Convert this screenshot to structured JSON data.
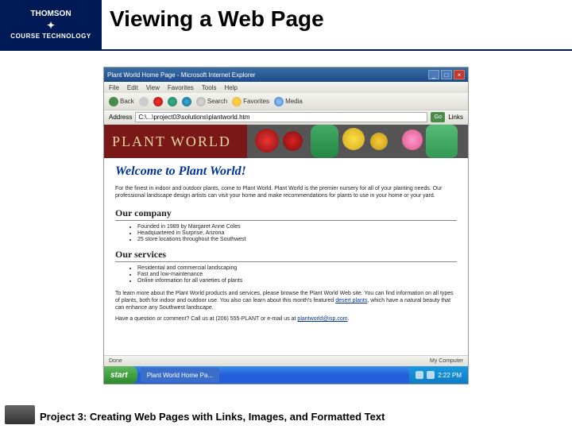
{
  "slide": {
    "logo_top": "THOMSON",
    "logo_bottom": "COURSE TECHNOLOGY",
    "title": "Viewing a Web Page",
    "footer": "Project 3: Creating Web Pages with Links, Images, and Formatted Text"
  },
  "browser": {
    "window_title": "Plant World Home Page - Microsoft Internet Explorer",
    "menu": [
      "File",
      "Edit",
      "View",
      "Favorites",
      "Tools",
      "Help"
    ],
    "toolbar": {
      "back": "Back",
      "search": "Search",
      "favorites": "Favorites",
      "media": "Media"
    },
    "address_label": "Address",
    "address_value": "C:\\...\\project03\\solutions\\plantworld.htm",
    "go_label": "Go",
    "links_label": "Links",
    "status_left": "Done",
    "status_right": "My Computer"
  },
  "page": {
    "banner_title": "PLANT WORLD",
    "welcome": "Welcome to Plant World!",
    "intro": "For the finest in indoor and outdoor plants, come to Plant World. Plant World is the premier nursery for all of your planting needs. Our professional landscape design artists can visit your home and make recommendations for plants to use in your home or your yard.",
    "company_heading": "Our company",
    "company_bullets": [
      "Founded in 1989 by Margaret Anne Coles",
      "Headquartered in Surprise, Arizona",
      "25 store locations throughout the Southwest"
    ],
    "services_heading": "Our services",
    "services_bullets": [
      "Residential and commercial landscaping",
      "Fast and low-maintenance",
      "Online information for all varieties of plants"
    ],
    "more_para_1": "To learn more about the Plant World products and services, please browse the Plant World Web site. You can find information on all types of plants, both for indoor and outdoor use. You also can learn about this month's featured ",
    "more_link": "desert plants",
    "more_para_2": ", which have a natural beauty that can enhance any Southwest landscape.",
    "question_prefix": "Have a question or comment? Call us at (206) 555-PLANT or e-mail us at ",
    "email": "plantworld@isp.com",
    "question_suffix": "."
  },
  "taskbar": {
    "start": "start",
    "task1": "Plant World Home Pa...",
    "clock": "2:22 PM"
  }
}
